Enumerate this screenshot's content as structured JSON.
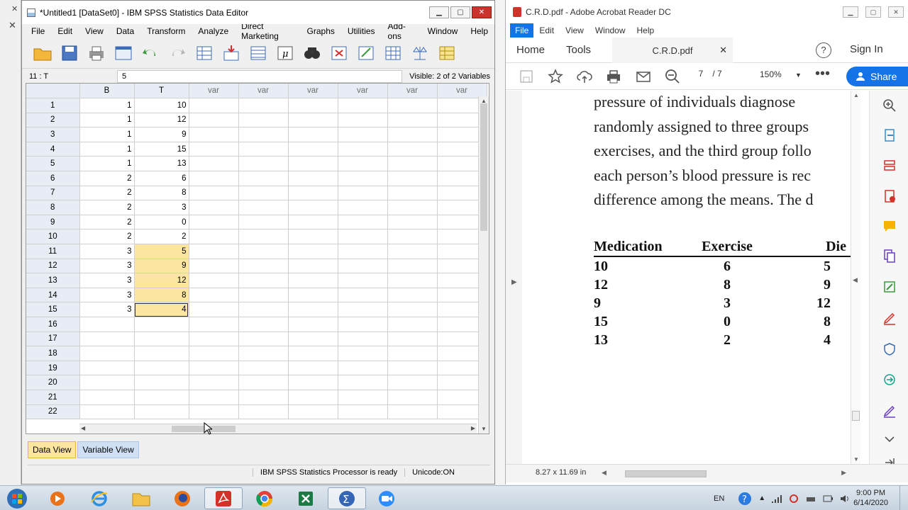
{
  "spss": {
    "title": "*Untitled1 [DataSet0] - IBM SPSS Statistics Data Editor",
    "menu": [
      "File",
      "Edit",
      "View",
      "Data",
      "Transform",
      "Analyze",
      "Direct Marketing",
      "Graphs",
      "Utilities",
      "Add-ons",
      "Window",
      "Help"
    ],
    "cell_ref": "11 : T",
    "cell_value": "5",
    "visible": "Visible: 2 of 2 Variables",
    "columns": [
      "B",
      "T",
      "var",
      "var",
      "var",
      "var",
      "var",
      "var"
    ],
    "rows": [
      {
        "n": "1",
        "B": "1",
        "T": "10"
      },
      {
        "n": "2",
        "B": "1",
        "T": "12"
      },
      {
        "n": "3",
        "B": "1",
        "T": "9"
      },
      {
        "n": "4",
        "B": "1",
        "T": "15"
      },
      {
        "n": "5",
        "B": "1",
        "T": "13"
      },
      {
        "n": "6",
        "B": "2",
        "T": "6"
      },
      {
        "n": "7",
        "B": "2",
        "T": "8"
      },
      {
        "n": "8",
        "B": "2",
        "T": "3"
      },
      {
        "n": "9",
        "B": "2",
        "T": "0"
      },
      {
        "n": "10",
        "B": "2",
        "T": "2"
      },
      {
        "n": "11",
        "B": "3",
        "T": "5"
      },
      {
        "n": "12",
        "B": "3",
        "T": "9"
      },
      {
        "n": "13",
        "B": "3",
        "T": "12"
      },
      {
        "n": "14",
        "B": "3",
        "T": "8"
      },
      {
        "n": "15",
        "B": "3",
        "T": "4"
      },
      {
        "n": "16",
        "B": "",
        "T": ""
      },
      {
        "n": "17",
        "B": "",
        "T": ""
      },
      {
        "n": "18",
        "B": "",
        "T": ""
      },
      {
        "n": "19",
        "B": "",
        "T": ""
      },
      {
        "n": "20",
        "B": "",
        "T": ""
      },
      {
        "n": "21",
        "B": "",
        "T": ""
      },
      {
        "n": "22",
        "B": "",
        "T": ""
      }
    ],
    "tabs": {
      "data_view": "Data View",
      "variable_view": "Variable View"
    },
    "status": {
      "processor": "IBM SPSS Statistics Processor is ready",
      "unicode": "Unicode:ON"
    }
  },
  "acrobat": {
    "title": "C.R.D.pdf - Adobe Acrobat Reader DC",
    "menu": [
      "File",
      "Edit",
      "View",
      "Window",
      "Help"
    ],
    "nav": {
      "home": "Home",
      "tools": "Tools",
      "doc_tab": "C.R.D.pdf",
      "sign_in": "Sign In"
    },
    "page_current": "7",
    "page_total": "/ 7",
    "zoom": "150%",
    "share": "Share",
    "paragraph": [
      "pressure of individuals diagnose",
      "randomly assigned to three groups",
      "exercises, and the third group follo",
      "each person’s blood pressure is rec",
      "difference among the means. The d"
    ],
    "table_headers": [
      "Medication",
      "Exercise",
      "Die"
    ],
    "table_rows": [
      [
        "10",
        "6",
        "5"
      ],
      [
        "12",
        "8",
        "9"
      ],
      [
        "9",
        "3",
        "12"
      ],
      [
        "15",
        "0",
        "8"
      ],
      [
        "13",
        "2",
        "4"
      ]
    ],
    "page_size": "8.27 x 11.69 in"
  },
  "taskbar": {
    "lang": "EN",
    "time": "9:00 PM",
    "date": "6/14/2020"
  }
}
